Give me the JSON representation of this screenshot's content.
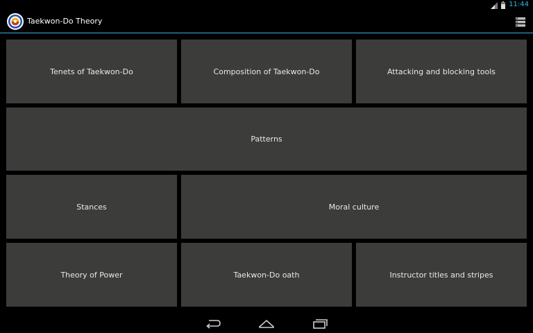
{
  "status_bar": {
    "time": "11:44",
    "signal_icon": "signal-icon",
    "battery_icon": "battery-icon",
    "time_color": "#33b5e5"
  },
  "action_bar": {
    "title": "Taekwon-Do Theory",
    "app_icon": "taekwondo-emblem-icon",
    "overflow_icon": "overflow-menu-icon",
    "accent": "#33b5e5"
  },
  "tiles": [
    {
      "label": "Tenets of Taekwon-Do"
    },
    {
      "label": "Composition of Taekwon-Do"
    },
    {
      "label": "Attacking and blocking tools"
    },
    {
      "label": "Patterns"
    },
    {
      "label": "Stances"
    },
    {
      "label": "Moral culture"
    },
    {
      "label": "Theory of Power"
    },
    {
      "label": "Taekwon-Do oath"
    },
    {
      "label": "Instructor titles and stripes"
    }
  ],
  "nav_bar": {
    "back_icon": "back-icon",
    "home_icon": "home-icon",
    "recents_icon": "recent-apps-icon"
  },
  "colors": {
    "tile_background": "#3c3d3b",
    "screen_background": "#000000"
  }
}
